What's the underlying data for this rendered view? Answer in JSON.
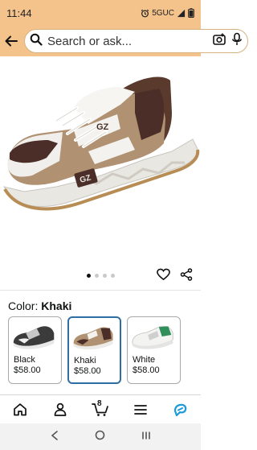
{
  "status": {
    "time": "11:44",
    "network": "5GUC"
  },
  "search": {
    "placeholder": "Search or ask..."
  },
  "carousel": {
    "count": 4,
    "active_index": 0
  },
  "product": {
    "color_label": "Color:",
    "color_value": "Khaki",
    "variants": [
      {
        "name": "Black",
        "price": "$58.00",
        "selected": false
      },
      {
        "name": "Khaki",
        "price": "$58.00",
        "selected": true
      },
      {
        "name": "White",
        "price": "$58.00",
        "selected": false
      }
    ]
  },
  "tabbar": {
    "cart_count": "8",
    "items": [
      "home-icon",
      "account-icon",
      "cart-icon",
      "menu-icon",
      "rufus-icon"
    ]
  },
  "colors": {
    "header_bg": "#f3c38b",
    "selected_border": "#2d6ea6",
    "rufus_blue": "#1a9bd7"
  }
}
